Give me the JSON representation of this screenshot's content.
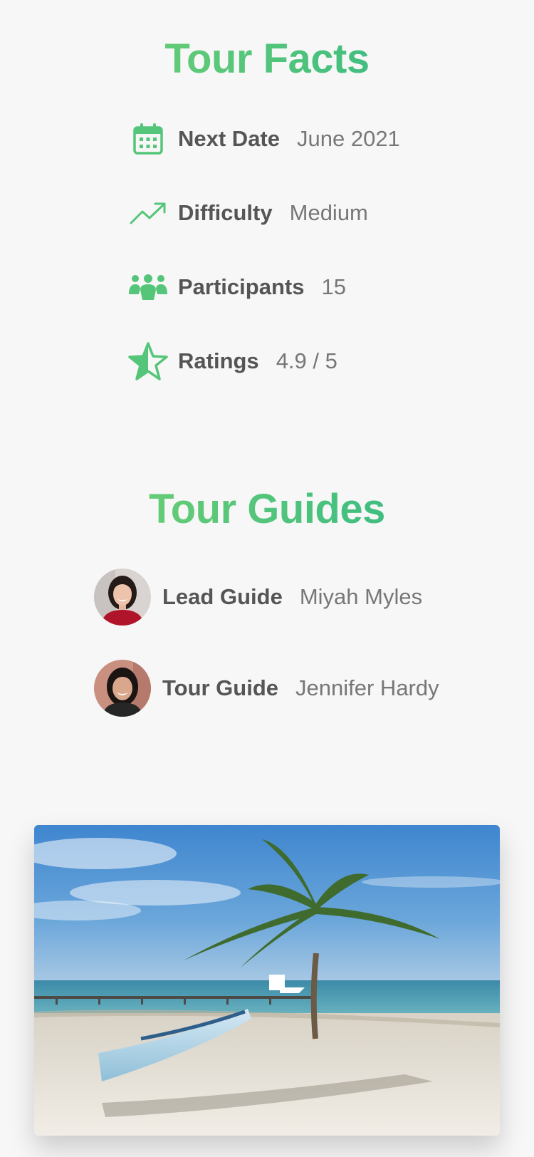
{
  "facts": {
    "title": "Tour Facts",
    "items": [
      {
        "icon": "calendar-icon",
        "label": "Next Date",
        "value": "June 2021"
      },
      {
        "icon": "trending-up-icon",
        "label": "Difficulty",
        "value": "Medium"
      },
      {
        "icon": "users-icon",
        "label": "Participants",
        "value": "15"
      },
      {
        "icon": "star-icon",
        "label": "Ratings",
        "value": "4.9 / 5"
      }
    ]
  },
  "guides": {
    "title": "Tour Guides",
    "items": [
      {
        "role": "Lead Guide",
        "name": "Miyah Myles"
      },
      {
        "role": "Tour Guide",
        "name": "Jennifer Hardy"
      }
    ]
  },
  "colors": {
    "accent_light": "#7dd56f",
    "accent_dark": "#28b487",
    "label": "#555555",
    "value": "#777777",
    "background": "#f7f7f7"
  }
}
